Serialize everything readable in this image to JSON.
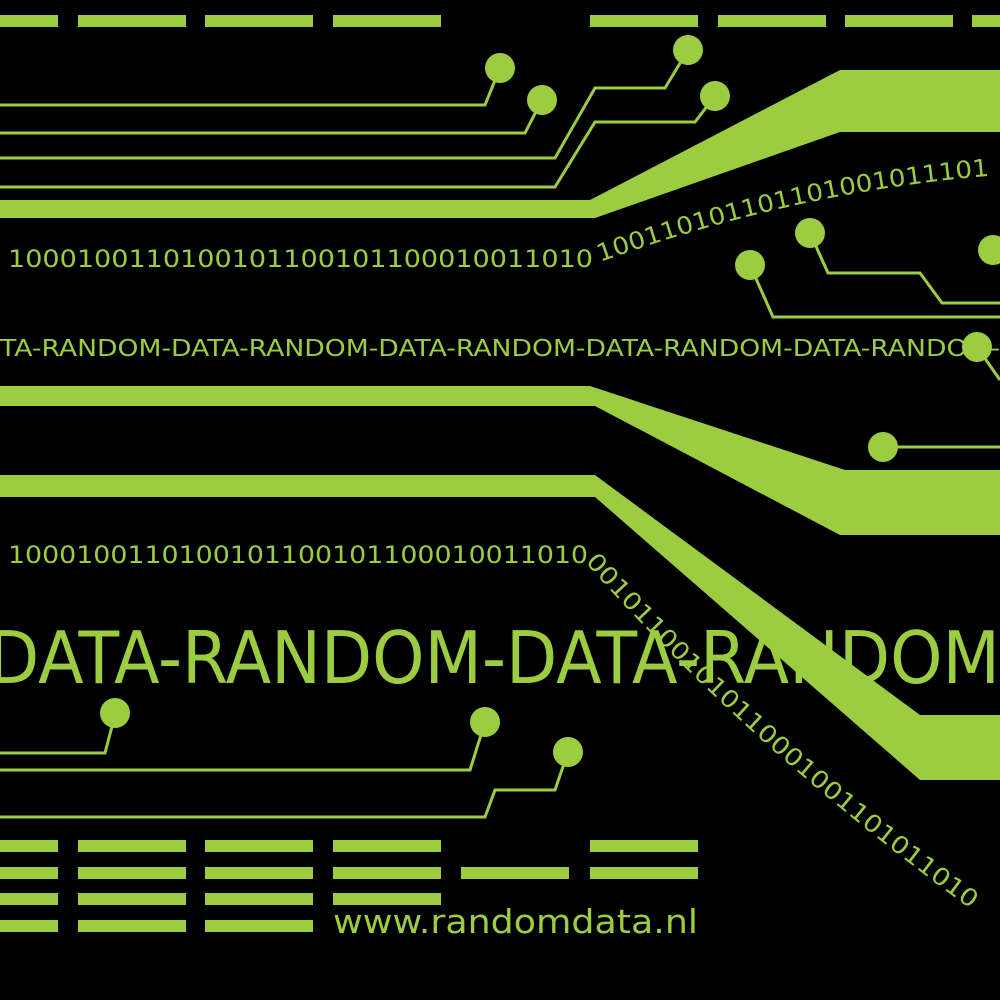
{
  "colors": {
    "background": "#000000",
    "accent": "#9ccc40"
  },
  "binary_top": "1000100110100101100101100010011010",
  "binary_upper_curve": "100110101101101001011101",
  "binary_mid": "1000100110100101100101100010011010",
  "binary_lower_curve": "001011001010110001001101011010",
  "random_small": "TA-RANDOM-DATA-RANDOM-DATA-RANDOM-DATA-RANDOM-DATA-RANDOM-",
  "random_large": "DATA-RANDOM-DATA-RANDOM",
  "website": "www.randomdata.nl"
}
